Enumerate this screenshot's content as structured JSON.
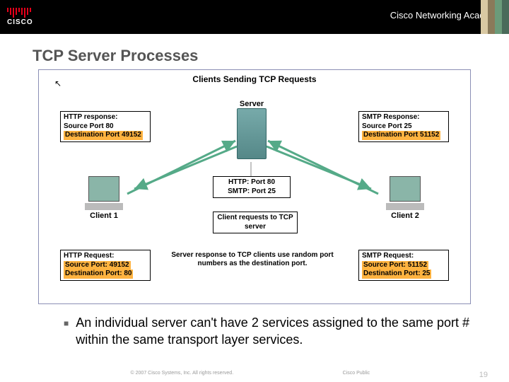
{
  "header": {
    "brand": "CISCO",
    "academy": "Cisco Networking Academy"
  },
  "title": "TCP Server Processes",
  "diagram": {
    "title": "Clients Sending TCP Requests",
    "server_label": "Server",
    "ports_box": {
      "l1": "HTTP: Port 80",
      "l2": "SMTP: Port 25"
    },
    "client_req_box": "Client requests to TCP server",
    "dest_note": "Server response to TCP clients use random port numbers as the destination port.",
    "client1": "Client 1",
    "client2": "Client 2",
    "resp1": {
      "t": "HTTP response:",
      "l1": "Source Port 80",
      "l2": "Destination Port 49152"
    },
    "resp2": {
      "t": "SMTP Response:",
      "l1": "Source Port 25",
      "l2": "Destination Port 51152"
    },
    "req1": {
      "t": "HTTP Request:",
      "l1": "Source Port: 49152",
      "l2": "Destination Port: 80"
    },
    "req2": {
      "t": "SMTP Request:",
      "l1": "Source Port: 51152",
      "l2": "Destination Port: 25"
    }
  },
  "bullet": "An individual server can't have 2 services assigned to the same port # within the same transport layer services.",
  "footer": {
    "copyright": "© 2007 Cisco Systems, Inc. All rights reserved.",
    "label": "Cisco Public",
    "page": "19"
  }
}
